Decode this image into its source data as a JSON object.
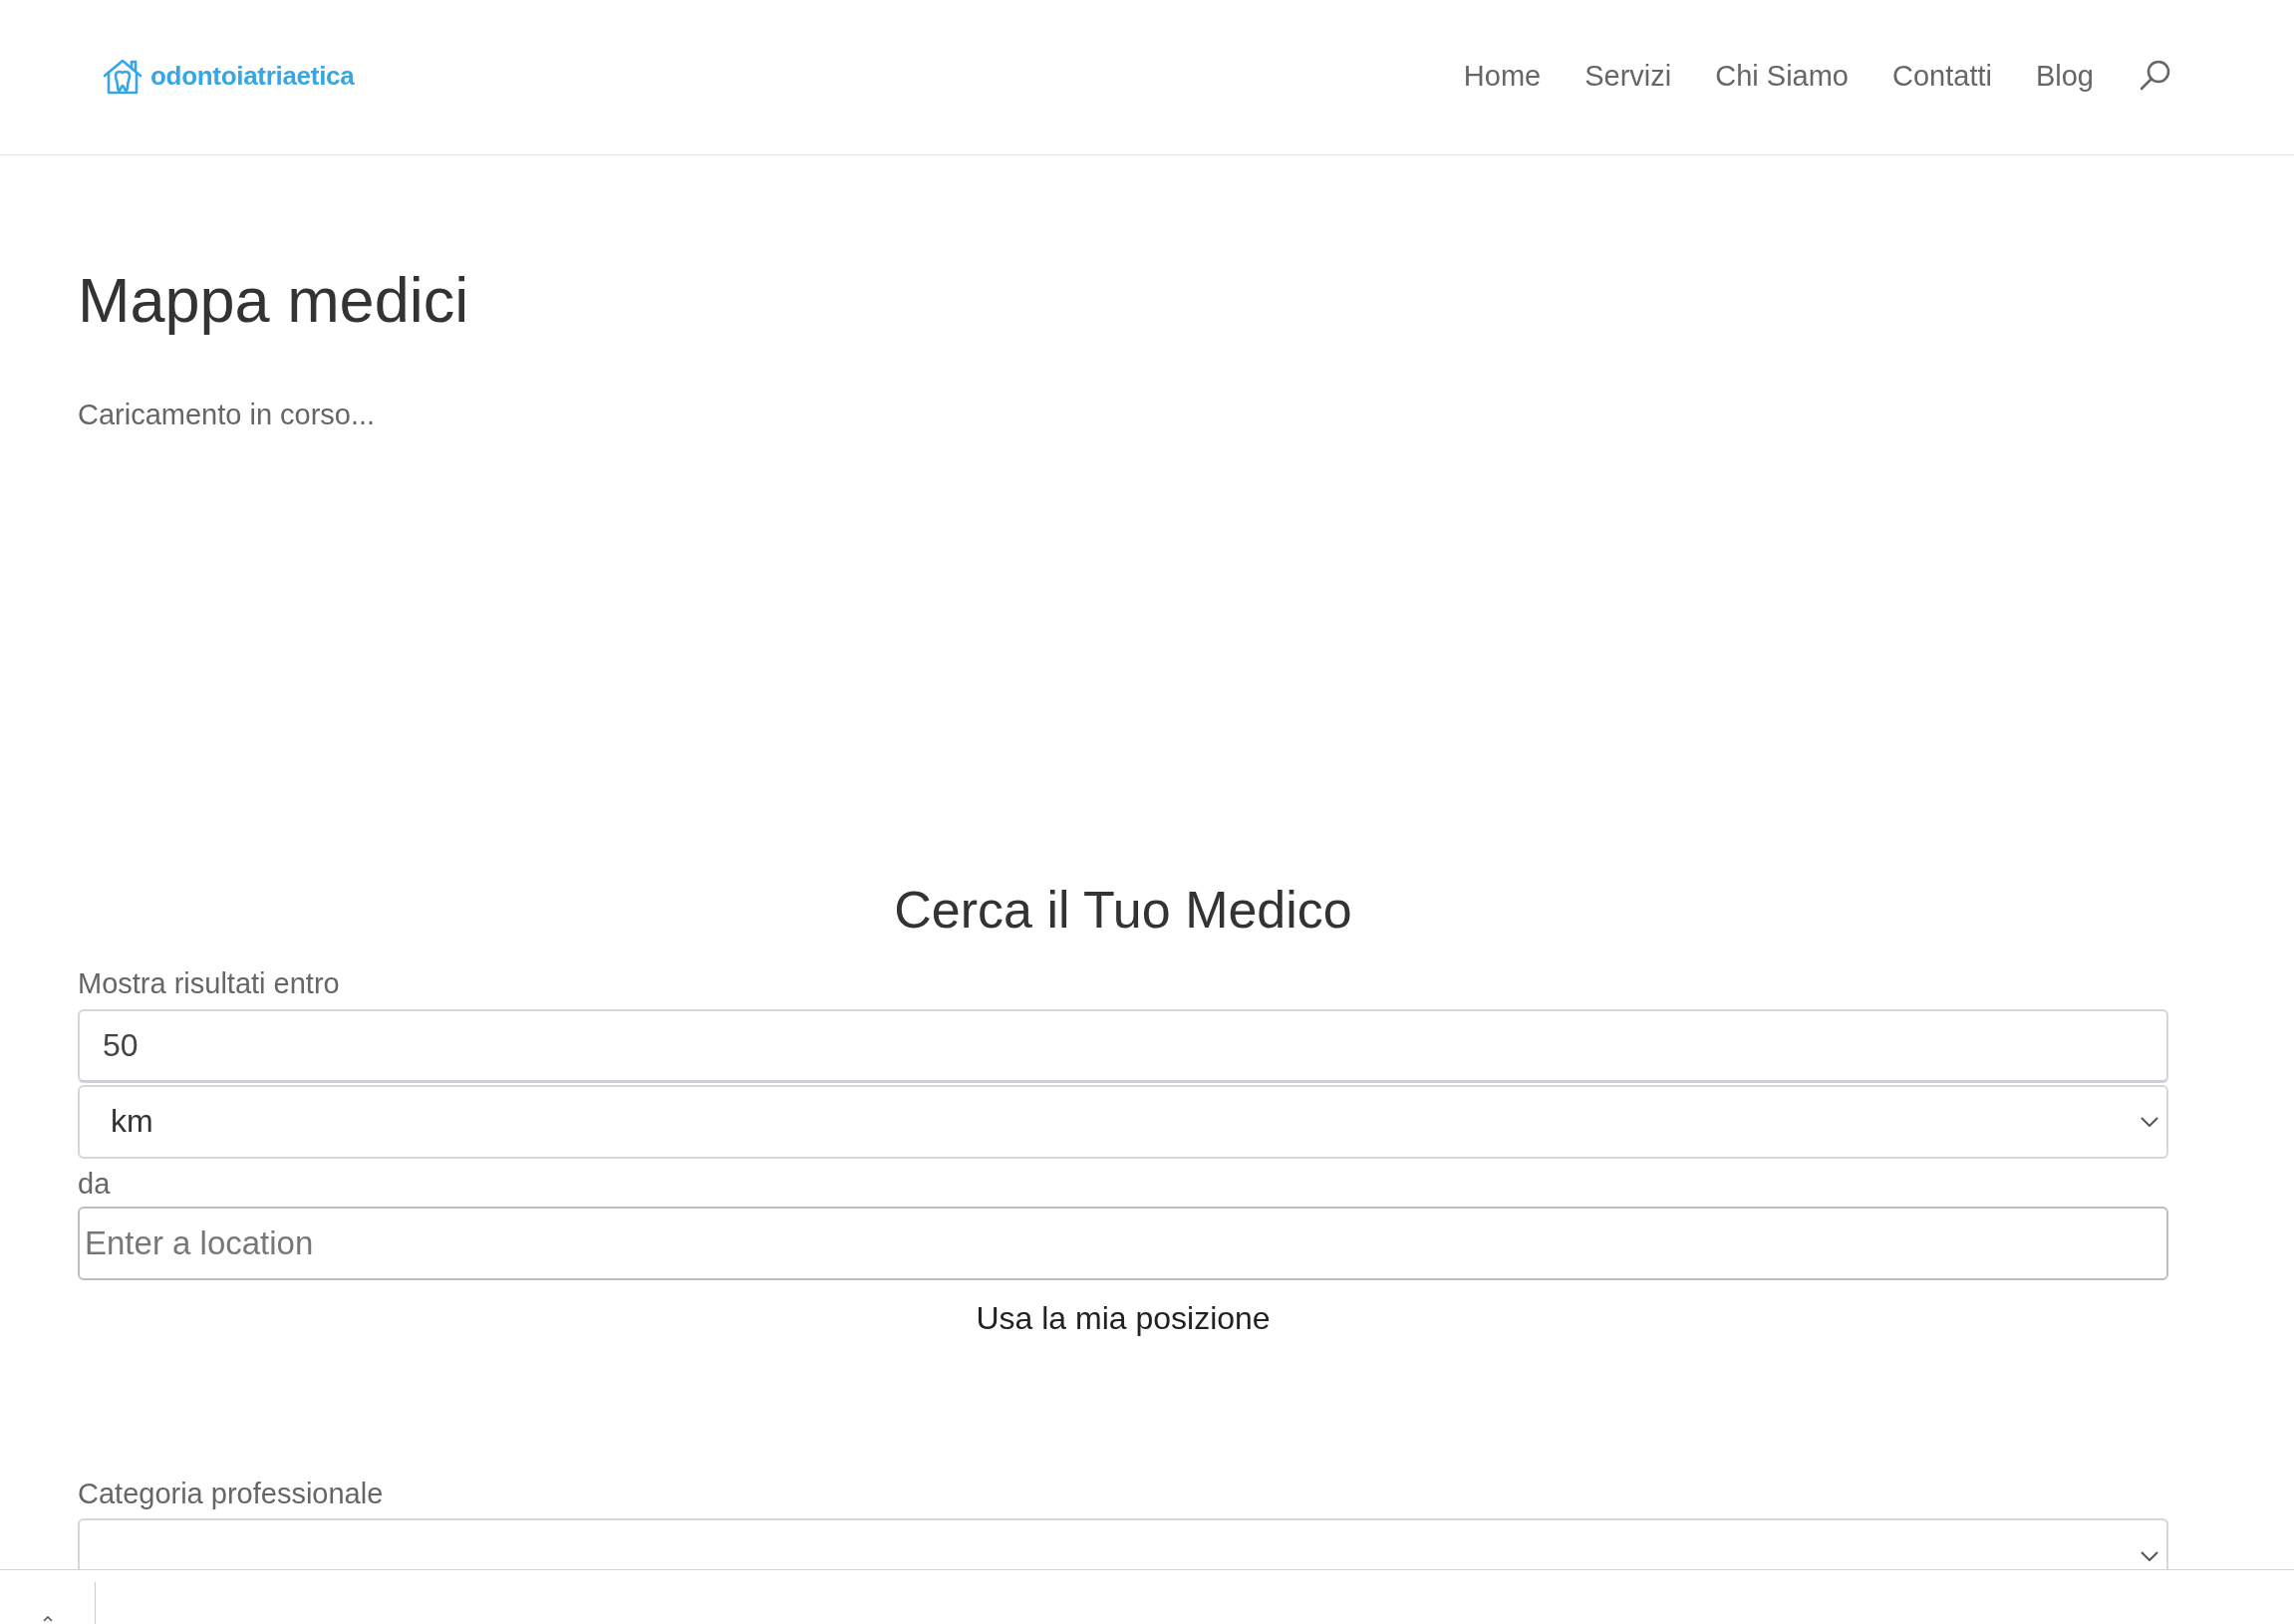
{
  "header": {
    "logo": {
      "text": "odontoiatriaetica"
    },
    "nav": [
      {
        "label": "Home"
      },
      {
        "label": "Servizi"
      },
      {
        "label": "Chi Siamo"
      },
      {
        "label": "Contatti"
      },
      {
        "label": "Blog"
      }
    ]
  },
  "page": {
    "title": "Mappa medici",
    "loading_text": "Caricamento in corso..."
  },
  "search_form": {
    "title": "Cerca il Tuo Medico",
    "radius": {
      "label": "Mostra risultati entro",
      "value": "50"
    },
    "unit": {
      "value": "km"
    },
    "origin": {
      "label": "da",
      "placeholder": "Enter a location"
    },
    "locate_button": {
      "label": "Usa la mia posizione"
    },
    "category": {
      "label": "Categoria professionale"
    }
  }
}
